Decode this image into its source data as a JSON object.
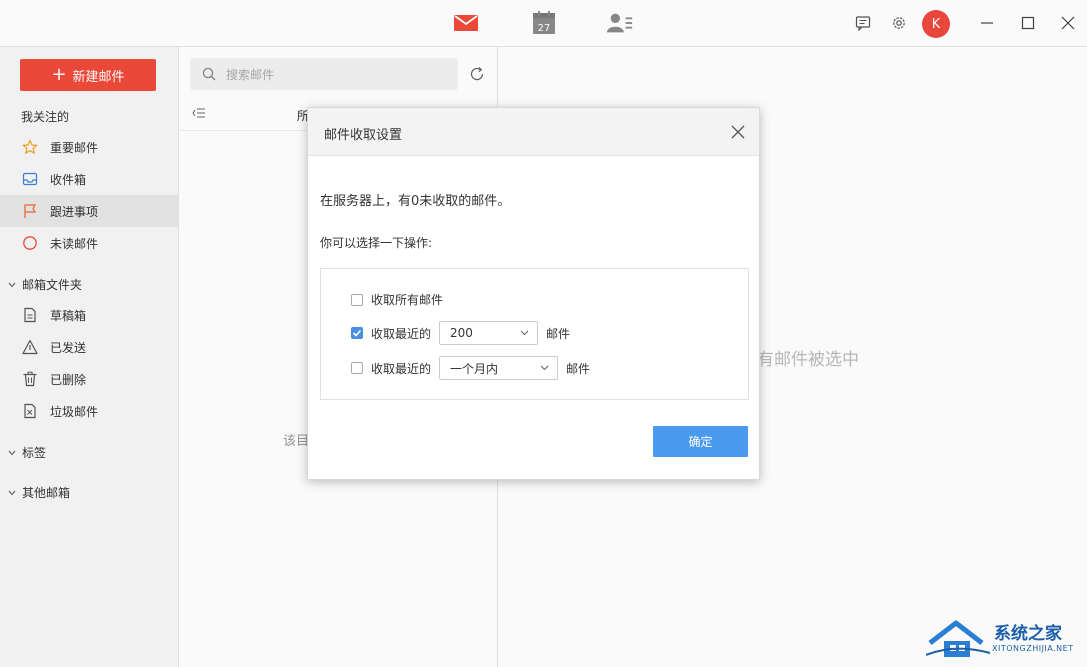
{
  "titlebar": {
    "calendar_day": "27",
    "avatar_letter": "K",
    "accent_color": "#ef4b3c"
  },
  "sidebar": {
    "new_mail_label": "新建邮件",
    "favorites_title": "我关注的",
    "favorites": [
      {
        "label": "重要邮件",
        "icon": "star-icon"
      },
      {
        "label": "收件箱",
        "icon": "inbox-icon"
      },
      {
        "label": "跟进事项",
        "icon": "flag-icon",
        "active": true
      },
      {
        "label": "未读邮件",
        "icon": "unread-circle-icon"
      }
    ],
    "folders_title": "邮箱文件夹",
    "folders": [
      {
        "label": "草稿箱",
        "icon": "draft-icon"
      },
      {
        "label": "已发送",
        "icon": "sent-icon"
      },
      {
        "label": "已删除",
        "icon": "trash-icon"
      },
      {
        "label": "垃圾邮件",
        "icon": "spam-icon"
      }
    ],
    "tags_title": "标签",
    "other_title": "其他邮箱"
  },
  "list": {
    "search_placeholder": "搜索邮件",
    "header_label": "所",
    "empty_text": "该目"
  },
  "reading": {
    "no_selection_text": "有邮件被选中"
  },
  "dialog": {
    "title": "邮件收取设置",
    "message": "在服务器上，有0未收取的邮件。",
    "subtitle": "你可以选择一下操作:",
    "options": {
      "all_label": "收取所有邮件",
      "all_checked": false,
      "recent_label": "收取最近的",
      "recent_value": "200",
      "recent_suffix": "邮件",
      "recent_checked": true,
      "period_label": "收取最近的",
      "period_value": "一个月内",
      "period_suffix": "邮件",
      "period_checked": false
    },
    "ok_label": "确定"
  },
  "watermark": {
    "title": "系统之家",
    "subtitle": "XITONGZHIJIA.NET"
  }
}
